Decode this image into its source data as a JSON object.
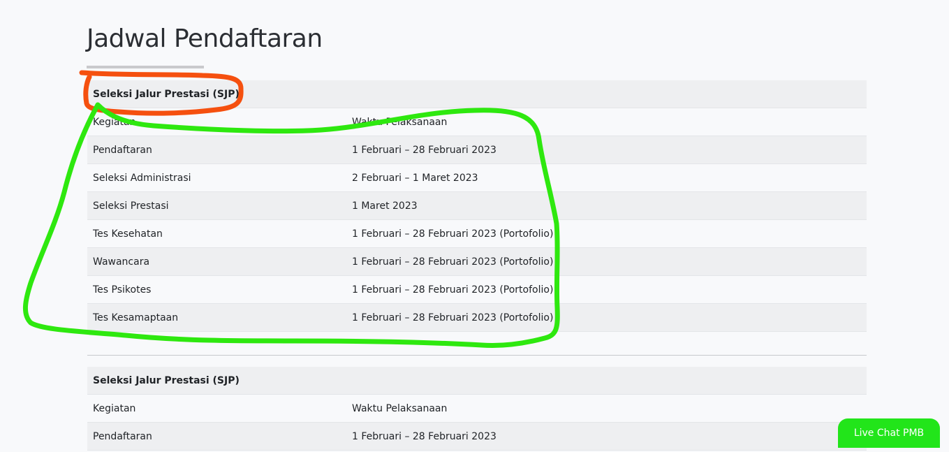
{
  "page": {
    "title": "Jadwal Pendaftaran"
  },
  "tables": [
    {
      "header": "Seleksi Jalur Prestasi (SJP)",
      "columns": [
        "Kegiatan",
        "Waktu Pelaksanaan"
      ],
      "rows": [
        [
          "Pendaftaran",
          "1 Februari – 28 Februari 2023"
        ],
        [
          "Seleksi Administrasi",
          "2 Februari – 1 Maret 2023"
        ],
        [
          "Seleksi Prestasi",
          "1 Maret 2023"
        ],
        [
          "Tes Kesehatan",
          "1 Februari – 28 Februari 2023 (Portofolio)"
        ],
        [
          "Wawancara",
          "1 Februari – 28 Februari 2023 (Portofolio)"
        ],
        [
          "Tes Psikotes",
          "1 Februari – 28 Februari 2023 (Portofolio)"
        ],
        [
          "Tes Kesamaptaan",
          "1 Februari – 28 Februari 2023 (Portofolio)"
        ]
      ]
    },
    {
      "header": "Seleksi Jalur Prestasi (SJP)",
      "columns": [
        "Kegiatan",
        "Waktu Pelaksanaan"
      ],
      "rows": [
        [
          "Pendaftaran",
          "1 Februari – 28 Februari 2023"
        ]
      ]
    }
  ],
  "live_chat": {
    "label": "Live Chat PMB"
  },
  "annotations": {
    "orange_color": "#f5500f",
    "green_color": "#2ee80f"
  },
  "colors": {
    "background": "#f8f9fb",
    "row_striped": "#eeeff1",
    "live_chat_bg": "#22e51a"
  }
}
